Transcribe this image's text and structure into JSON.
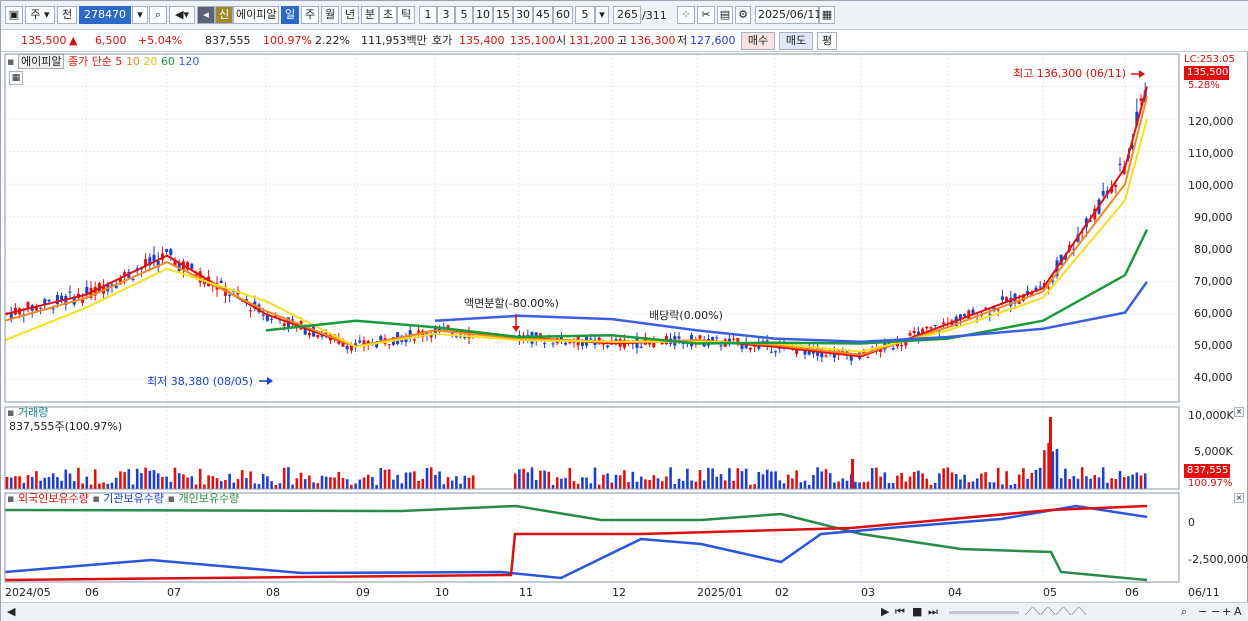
{
  "toolbar": {
    "mode": "주",
    "prev": "전",
    "code": "278470",
    "name": "에이피알",
    "flag": "신",
    "periods": [
      "일",
      "주",
      "월",
      "년",
      "분",
      "초",
      "틱"
    ],
    "active_period": "일",
    "nums": [
      "1",
      "3",
      "5",
      "10",
      "15",
      "30",
      "45",
      "60"
    ],
    "n_input": "5",
    "count": "265",
    "total": "/311",
    "date": "2025/06/11"
  },
  "quote": {
    "price": "135,500",
    "arrow": "▲",
    "change": "6,500",
    "pct": "+5.04%",
    "volume": "837,555",
    "vol_ratio": "100.97%",
    "turnover": "2.22%",
    "amount": "111,953백만",
    "bid_label": "호가",
    "ask": "135,400",
    "bid": "135,100",
    "open_label": "시",
    "open": "131,200",
    "high_label": "고",
    "high": "136,300",
    "low_label": "저",
    "low": "127,600",
    "buy": "매수",
    "sell": "매도",
    "eval": "평"
  },
  "price_panel": {
    "title": "에이피알",
    "legend": [
      "종가 단순 5",
      "10",
      "20",
      "60",
      "120"
    ],
    "lc": "LC:253.05",
    "last": "135,500",
    "pct": "5.28%",
    "max_note": "최고 136,300 (06/11)",
    "min_note": "최저 38,380 (08/05)",
    "split_note": "액면분할(-80.00%)",
    "div_note": "배당락(0.00%)",
    "yticks": [
      "120,000",
      "110,000",
      "100,000",
      "90,000",
      "80,000",
      "70,000",
      "60,000",
      "50,000",
      "40,000"
    ]
  },
  "volume_panel": {
    "title": "거래량",
    "info": "837,555주(100.97%)",
    "yticks": [
      "10,000K",
      "5,000K"
    ],
    "last": "837,555",
    "pct": "100.97%"
  },
  "holding_panel": {
    "legend": [
      "외국인보유수량",
      "기관보유수량",
      "개인보유수량"
    ],
    "yticks": [
      "0",
      "-2,500,000"
    ]
  },
  "xaxis": [
    "2024/05",
    "06",
    "07",
    "08",
    "09",
    "10",
    "11",
    "12",
    "2025/01",
    "02",
    "03",
    "04",
    "05",
    "06",
    "06/11"
  ],
  "colors": {
    "up": "#e01010",
    "down": "#1c3fd0",
    "ma5": "#e01010",
    "ma10": "#f08a20",
    "ma20": "#f5e020",
    "ma60": "#1a9a3a",
    "ma120": "#3a60e0"
  },
  "chart_data": {
    "type": "line",
    "title": "에이피알",
    "xlabel": "",
    "ylabel": "",
    "ylim": [
      33000,
      140000
    ],
    "x": [
      "2024/05",
      "06",
      "07",
      "08",
      "09",
      "10",
      "11",
      "12",
      "2025/01",
      "02",
      "03",
      "04",
      "05",
      "06",
      "06/11"
    ],
    "series": [
      {
        "name": "종가 단순 5",
        "values": [
          60000,
          66000,
          78000,
          60000,
          50000,
          55000,
          53000,
          51000,
          52000,
          50000,
          47000,
          57000,
          68000,
          105000,
          130000
        ]
      },
      {
        "name": "10",
        "values": [
          58000,
          65000,
          76000,
          61000,
          50000,
          55000,
          52500,
          51500,
          52000,
          50500,
          47500,
          56000,
          67000,
          100000,
          127000
        ]
      },
      {
        "name": "20",
        "values": [
          52000,
          62000,
          74000,
          64000,
          50000,
          54000,
          52000,
          51500,
          51500,
          51000,
          48500,
          55000,
          65000,
          95000,
          120000
        ]
      },
      {
        "name": "60",
        "values": [
          null,
          null,
          null,
          55000,
          58000,
          56000,
          53000,
          53500,
          51000,
          51200,
          51000,
          52500,
          58000,
          72000,
          86000
        ]
      },
      {
        "name": "120",
        "values": [
          null,
          null,
          null,
          null,
          null,
          58000,
          59500,
          58500,
          55000,
          52500,
          51500,
          53000,
          55500,
          60500,
          70000
        ]
      }
    ],
    "annotations": [
      "최고 136,300 (06/11)",
      "최저 38,380 (08/05)",
      "액면분할(-80.00%)",
      "배당락(0.00%)"
    ]
  }
}
